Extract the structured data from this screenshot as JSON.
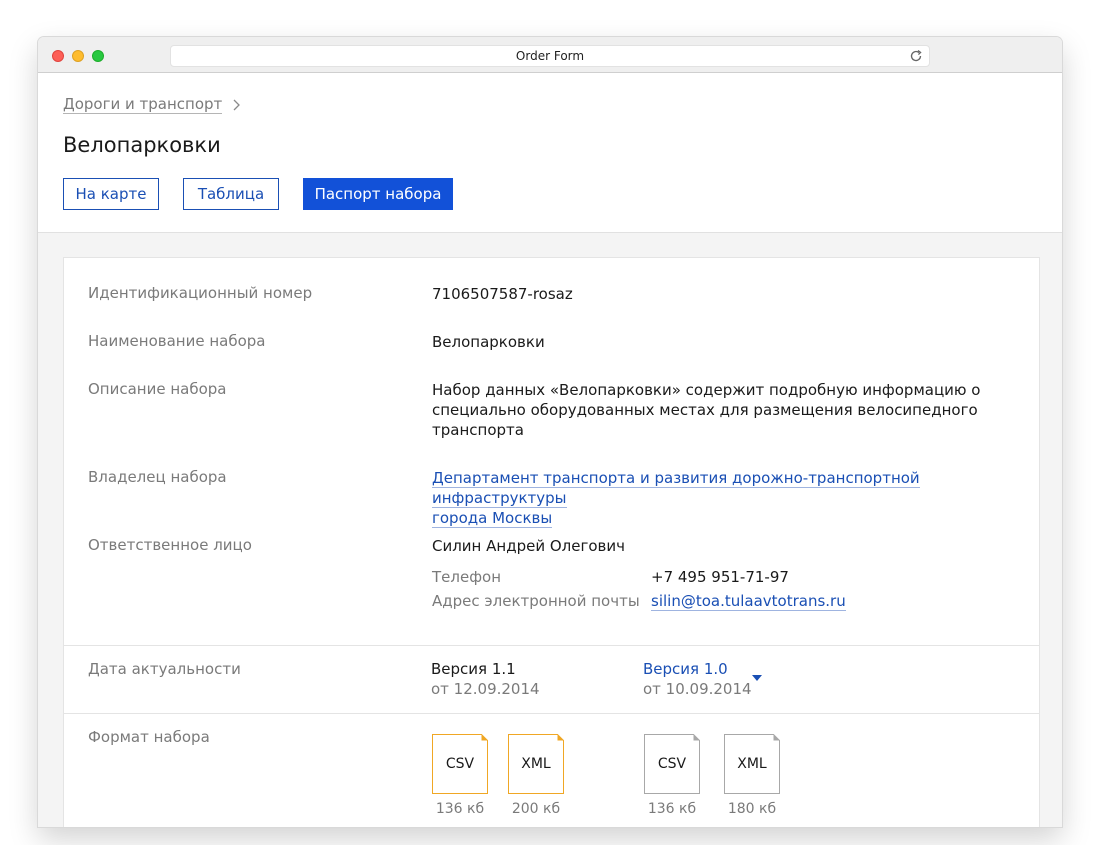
{
  "window": {
    "title": "Order Form"
  },
  "breadcrumb": {
    "label": "Дороги и транспорт"
  },
  "page": {
    "title": "Велопарковки"
  },
  "tabs": [
    {
      "label": "На карте",
      "active": false
    },
    {
      "label": "Таблица",
      "active": false
    },
    {
      "label": "Паспорт набора",
      "active": true
    }
  ],
  "passport": {
    "id_label": "Идентификационный номер",
    "id_value": "7106507587-rosaz",
    "name_label": "Наименование набора",
    "name_value": "Велопарковки",
    "desc_label": "Описание набора",
    "desc_line1": "Набор данных «Велопарковки» содержит подробную информацию о",
    "desc_line2": "специально оборудованных местах для размещения велосипедного",
    "desc_line3": "транспорта",
    "owner_label": "Владелец набора",
    "owner_line1": "Департамент транспорта и развития дорожно-транспортной инфраструктуры",
    "owner_line2": "города Москвы",
    "contact_label": "Ответственное лицо",
    "contact_name": "Силин Андрей Олегович",
    "phone_label": "Телефон",
    "phone_value": "+7 495 951-71-97",
    "email_label": "Адрес электронной почты",
    "email_value": "silin@toa.tulaavtotrans.ru",
    "date_label": "Дата актуальности",
    "versions": [
      {
        "name": "Версия 1.1",
        "date": "от 12.09.2014"
      },
      {
        "name": "Версия 1.0",
        "date": "от 10.09.2014"
      }
    ],
    "format_label": "Формат набора",
    "files": [
      {
        "ext": "CSV",
        "size": "136 кб",
        "color": "#f0a724"
      },
      {
        "ext": "XML",
        "size": "200 кб",
        "color": "#f0a724"
      },
      {
        "ext": "CSV",
        "size": "136 кб",
        "color": "#a8a8a8"
      },
      {
        "ext": "XML",
        "size": "180 кб",
        "color": "#a8a8a8"
      }
    ]
  },
  "colors": {
    "accent": "#1251d8",
    "link": "#1a4fb4",
    "muted": "#7a7a7a"
  }
}
